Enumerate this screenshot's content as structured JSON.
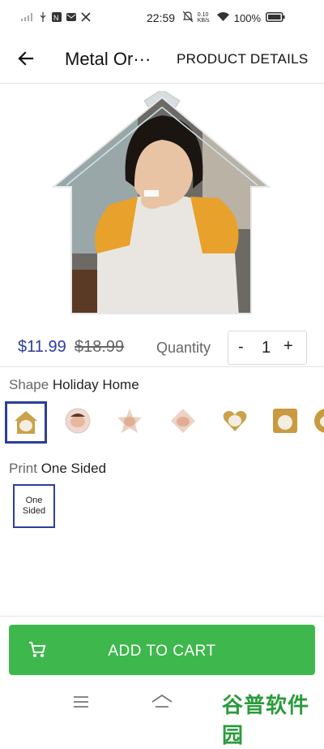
{
  "status_bar": {
    "time": "22:59",
    "network_speed": "0.10 KB/s",
    "battery": "100%",
    "icons": [
      "signal-icon",
      "usb-icon",
      "notification-icon",
      "mail-icon",
      "tools-icon",
      "mute-icon",
      "wifi-icon",
      "battery-icon"
    ]
  },
  "header": {
    "back_icon": "arrow-left-icon",
    "title": "Metal Or···",
    "details_tab": "PRODUCT DETAILS"
  },
  "product": {
    "image": "house-shaped-ornament-photo",
    "price": "$11.99",
    "old_price": "$18.99",
    "quantity_label": "Quantity",
    "quantity_minus": "-",
    "quantity_value": "1",
    "quantity_plus": "+"
  },
  "shape": {
    "label": "Shape",
    "selected": "Holiday Home",
    "options": [
      {
        "name": "house",
        "selected": true
      },
      {
        "name": "circle-baby",
        "selected": false
      },
      {
        "name": "star-baby",
        "selected": false
      },
      {
        "name": "diamond-baby",
        "selected": false
      },
      {
        "name": "heart-dog",
        "selected": false
      },
      {
        "name": "square-dog",
        "selected": false
      },
      {
        "name": "partial",
        "selected": false
      }
    ]
  },
  "print": {
    "label": "Print",
    "selected": "One Sided",
    "option_line1": "One",
    "option_line2": "Sided"
  },
  "cart_button": {
    "label": "ADD TO CART",
    "icon": "shopping-cart-icon",
    "color": "#3eb84c"
  },
  "nav_bar": {
    "menu_icon": "menu-icon",
    "home_icon": "home-icon",
    "watermark": "谷普软件园"
  },
  "colors": {
    "accent": "#2c3e9c",
    "cart_green": "#3eb84c"
  }
}
